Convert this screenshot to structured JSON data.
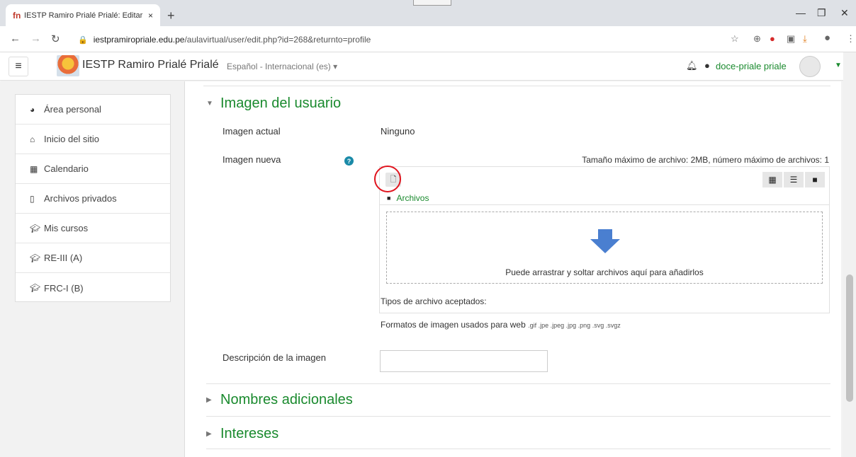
{
  "browser": {
    "tab_title": "IESTP Ramiro Prialé Prialé: Editar",
    "favicon_text": "fn",
    "close": "×",
    "newtab": "+",
    "url_prefix": "iestpramiropriale.edu.pe",
    "url_rest": "/aulavirtual/user/edit.php?id=268&returnto=profile"
  },
  "navbar": {
    "site_name": "IESTP Ramiro Prialé Prialé",
    "language": "Español - Internacional (es) ▾",
    "username": "doce-priale priale"
  },
  "sidebar": {
    "items": [
      {
        "label": "Área personal",
        "icon": "dashboard-icon"
      },
      {
        "label": "Inicio del sitio",
        "icon": "home-icon"
      },
      {
        "label": "Calendario",
        "icon": "calendar-icon"
      },
      {
        "label": "Archivos privados",
        "icon": "file-icon"
      },
      {
        "label": "Mis cursos",
        "icon": "graduation-cap-icon"
      },
      {
        "label": "RE-III (A)",
        "icon": "graduation-cap-icon"
      },
      {
        "label": "FRC-I (B)",
        "icon": "graduation-cap-icon"
      }
    ]
  },
  "main": {
    "section_user_image": "Imagen del usuario",
    "current_image_label": "Imagen actual",
    "current_image_value": "Ninguno",
    "new_image_label": "Imagen nueva",
    "max_size": "Tamaño máximo de archivo: 2MB, número máximo de archivos: 1",
    "folder_label": "Archivos",
    "drop_text": "Puede arrastrar y soltar archivos aquí para añadirlos",
    "accepted_types_label": "Tipos de archivo aceptados:",
    "formats_label": "Formatos de imagen usados para web",
    "formats_ext": ".gif .jpe .jpeg .jpg .png .svg .svgz",
    "image_description_label": "Descripción de la imagen",
    "section_additional_names": "Nombres adicionales",
    "section_interests": "Intereses"
  },
  "colors": {
    "accent_green": "#1a8a2e",
    "highlight_red": "#e0141e",
    "arrow_blue": "#4a7fd0"
  }
}
